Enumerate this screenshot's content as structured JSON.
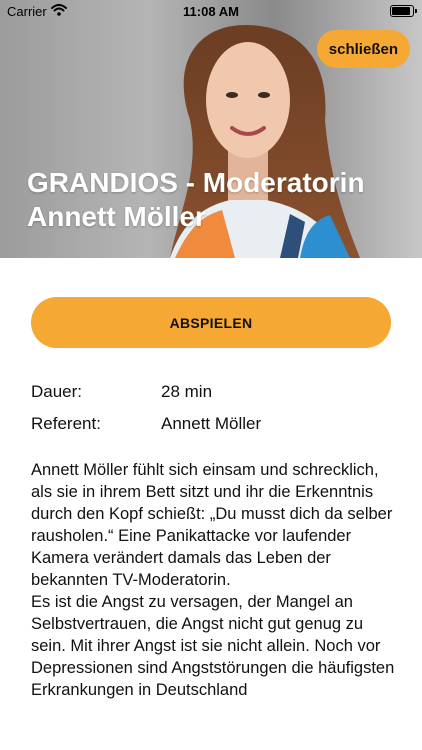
{
  "status": {
    "carrier": "Carrier",
    "time": "11:08 AM"
  },
  "hero": {
    "title": "GRANDIOS - Moderatorin Annett Möller",
    "close_label": "schließen"
  },
  "actions": {
    "play_label": "ABSPIELEN"
  },
  "meta": [
    {
      "label": "Dauer:",
      "value": "28 min"
    },
    {
      "label": "Referent:",
      "value": "Annett Möller"
    }
  ],
  "description": {
    "paragraph_1": "Annett Möller fühlt sich einsam und schrecklich, als sie in ihrem Bett sitzt und ihr die Erkenntnis durch den Kopf schießt: „Du musst dich da selber rausholen.“ Eine Panikattacke vor laufender Kamera verändert damals das Leben der bekannten TV-Moderatorin.",
    "paragraph_2": "Es ist die Angst zu versagen, der Mangel an Selbstvertrauen, die Angst nicht gut genug zu sein. Mit ihrer Angst ist sie nicht allein. Noch vor Depressionen sind Angststörungen die häufigsten Erkrankungen in Deutschland"
  },
  "colors": {
    "accent": "#f5a833"
  }
}
